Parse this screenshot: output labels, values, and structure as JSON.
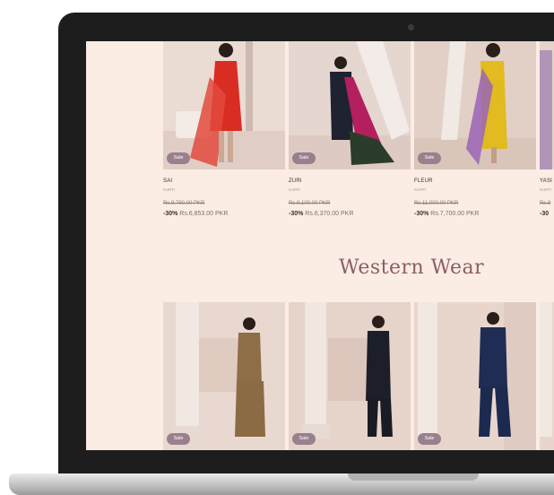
{
  "top_products": [
    {
      "name": "SAI",
      "category": "KURTI",
      "original_price": "Rs.9,790.00 PKR",
      "discount": "-30%",
      "sale_price": "Rs.6,853.00 PKR",
      "badge": "Sale"
    },
    {
      "name": "ZURI",
      "category": "KURTI",
      "original_price": "Rs.9,100.00 PKR",
      "discount": "-30%",
      "sale_price": "Rs.6,370.00 PKR",
      "badge": "Sale"
    },
    {
      "name": "FLEUR",
      "category": "KURTI",
      "original_price": "Rs.11,000.00 PKR",
      "discount": "-30%",
      "sale_price": "Rs.7,700.00 PKR",
      "badge": "Sale"
    },
    {
      "name": "YASI",
      "category": "KURTI",
      "original_price": "Rs.9",
      "discount": "-30",
      "sale_price": "",
      "badge": ""
    }
  ],
  "section_title": "Western Wear",
  "bottom_products": [
    {
      "badge": "Sale"
    },
    {
      "badge": "Sale"
    },
    {
      "badge": "Sale"
    },
    {
      "badge": ""
    }
  ],
  "colors": {
    "screen_bg": "#fbece4",
    "bezel": "#1d1d1d",
    "badge": "#9a7f8c",
    "heading": "#8b5e66"
  }
}
